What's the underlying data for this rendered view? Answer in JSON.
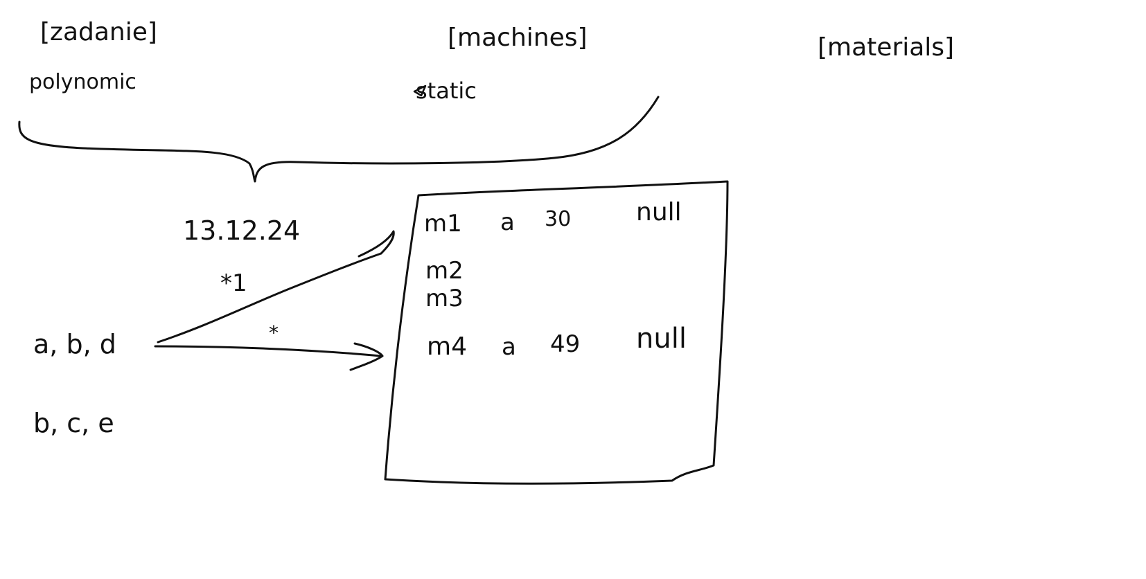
{
  "labels": {
    "zadanie": "[zadanie]",
    "polynomic": "polynomic",
    "machines": "[machines]",
    "static": "static",
    "materials": "[materials]",
    "date": "13.12.24",
    "star1": "*1",
    "star": "*",
    "abd": "a, b, d",
    "bce": "b, c, e"
  },
  "table": {
    "rows": [
      [
        "m1",
        "a",
        "30",
        "null"
      ],
      [
        "m2",
        "",
        "",
        ""
      ],
      [
        "m3",
        "",
        "",
        ""
      ],
      [
        "m4",
        "a",
        "49",
        "null"
      ]
    ]
  },
  "colors": {
    "ink": "#111111",
    "background": "#ffffff"
  }
}
